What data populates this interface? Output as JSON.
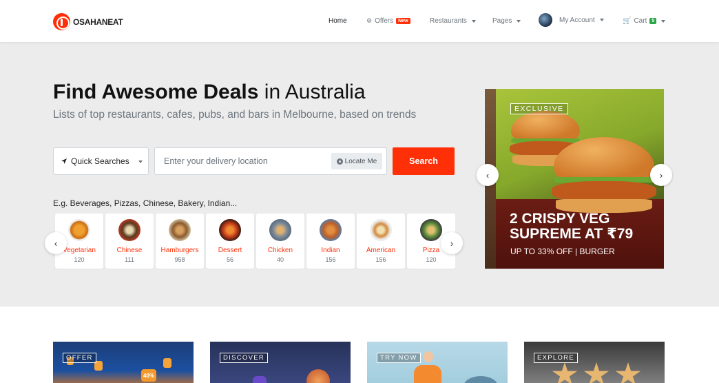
{
  "brand": {
    "name": "OSAHANEAT"
  },
  "nav": {
    "home": "Home",
    "offers": "Offers",
    "offers_badge": "New",
    "restaurants": "Restaurants",
    "pages": "Pages",
    "account": "My Account",
    "cart": "Cart",
    "cart_count": "5"
  },
  "hero": {
    "title_bold": "Find Awesome Deals",
    "title_rest": " in Australia",
    "subtitle": "Lists of top restaurants, cafes, pubs, and bars in Melbourne, based on trends",
    "quick_searches": "Quick Searches",
    "location_placeholder": "Enter your delivery location",
    "locate_me": "Locate Me",
    "search": "Search",
    "examples": "E.g. Beverages, Pizzas, Chinese, Bakery, Indian..."
  },
  "categories": [
    {
      "name": "Vegetarian",
      "count": "120"
    },
    {
      "name": "Chinese",
      "count": "111"
    },
    {
      "name": "Hamburgers",
      "count": "958"
    },
    {
      "name": "Dessert",
      "count": "56"
    },
    {
      "name": "Chicken",
      "count": "40"
    },
    {
      "name": "Indian",
      "count": "156"
    },
    {
      "name": "American",
      "count": "156"
    },
    {
      "name": "Pizza",
      "count": "120"
    }
  ],
  "banner": {
    "tag": "EXCLUSIVE",
    "headline_1": "2 CRISPY VEG",
    "headline_2": "SUPREME AT ₹79",
    "subline": "UP TO 33% OFF | BURGER"
  },
  "promos": [
    {
      "tag": "OFFER"
    },
    {
      "tag": "DISCOVER"
    },
    {
      "tag": "TRY NOW"
    },
    {
      "tag": "EXPLORE"
    }
  ],
  "colors": {
    "accent": "#ff3008",
    "hero_bg": "#ececec",
    "cart_badge": "#28a745"
  }
}
